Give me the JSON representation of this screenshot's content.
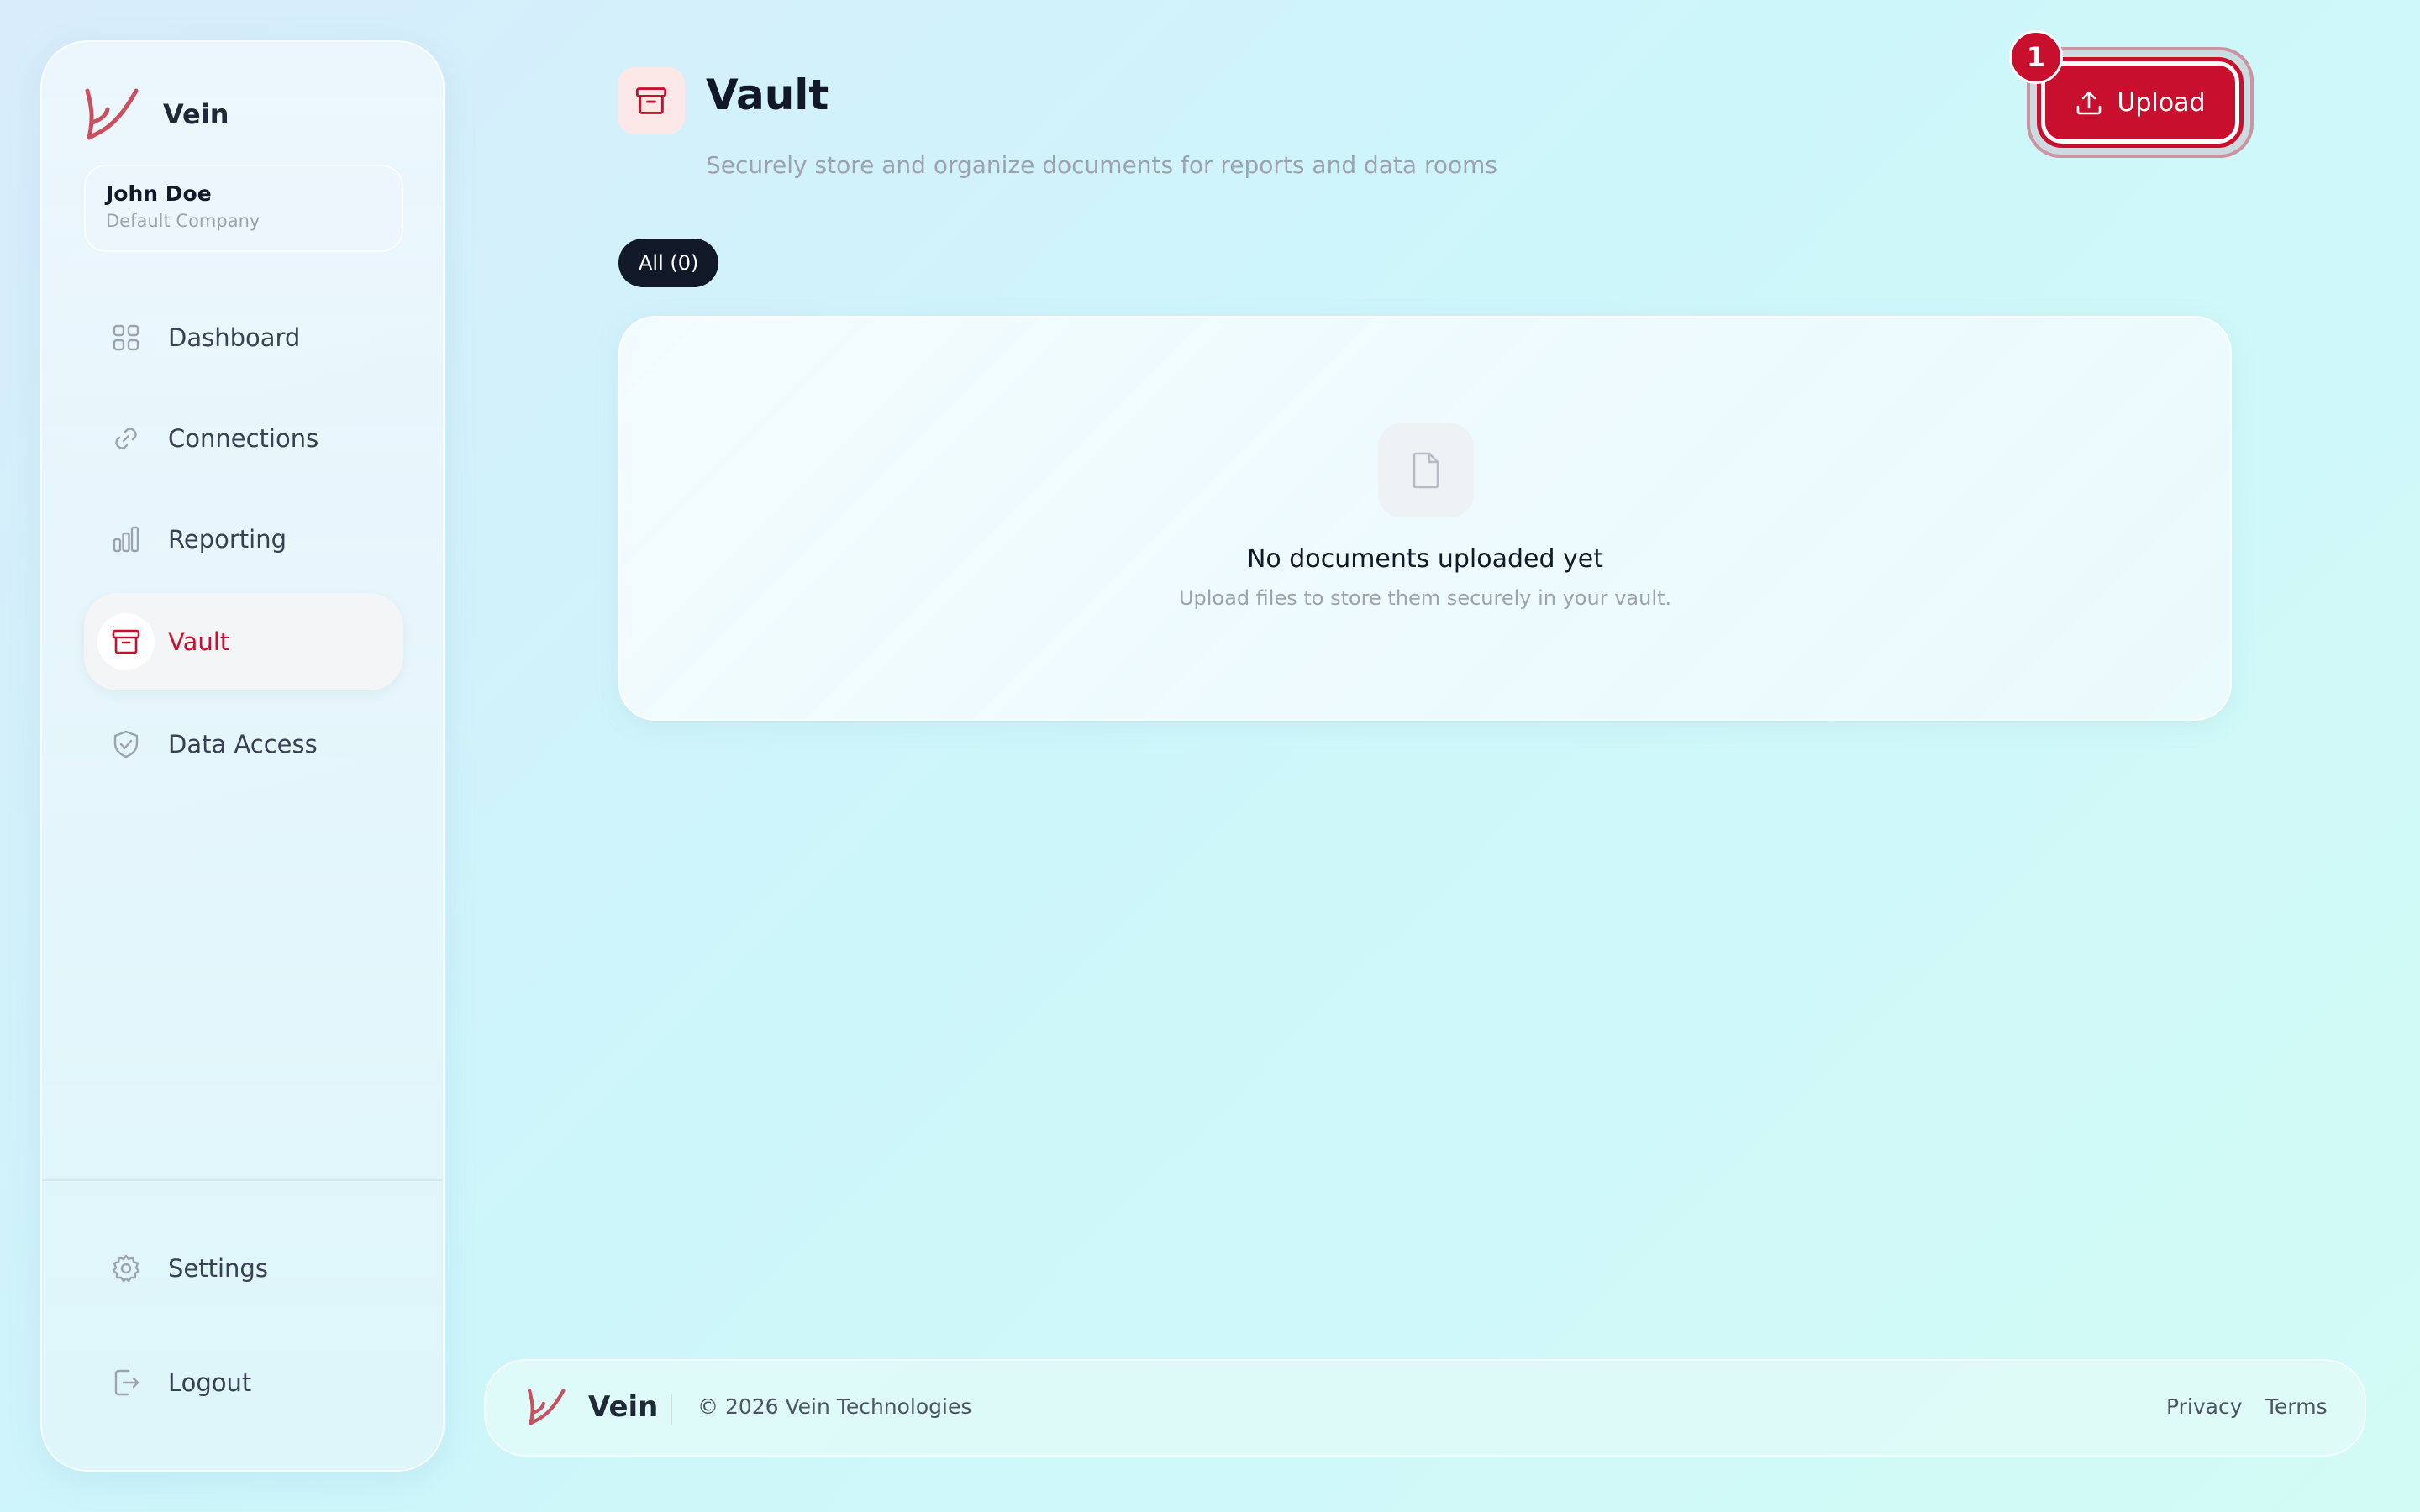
{
  "app": {
    "brand_name": "Vein",
    "accent_color": "#c8102e"
  },
  "user": {
    "name": "John Doe",
    "company": "Default Company"
  },
  "sidebar": {
    "items": [
      {
        "label": "Dashboard",
        "icon": "grid-icon"
      },
      {
        "label": "Connections",
        "icon": "link-icon"
      },
      {
        "label": "Reporting",
        "icon": "bar-chart-icon"
      },
      {
        "label": "Vault",
        "icon": "archive-icon",
        "active": true
      },
      {
        "label": "Data Access",
        "icon": "shield-check-icon"
      }
    ],
    "bottom_items": [
      {
        "label": "Settings",
        "icon": "gear-icon"
      },
      {
        "label": "Logout",
        "icon": "logout-icon"
      }
    ]
  },
  "header": {
    "title": "Vault",
    "subtitle": "Securely store and organize documents for reports and data rooms",
    "upload_label": "Upload",
    "badge": "1"
  },
  "filters": [
    {
      "label": "All (0)",
      "active": true
    }
  ],
  "empty_state": {
    "title": "No documents uploaded yet",
    "subtitle": "Upload files to store them securely in your vault."
  },
  "footer": {
    "brand_name": "Vein",
    "copyright": "© 2026 Vein Technologies",
    "links": [
      "Privacy",
      "Terms"
    ]
  }
}
